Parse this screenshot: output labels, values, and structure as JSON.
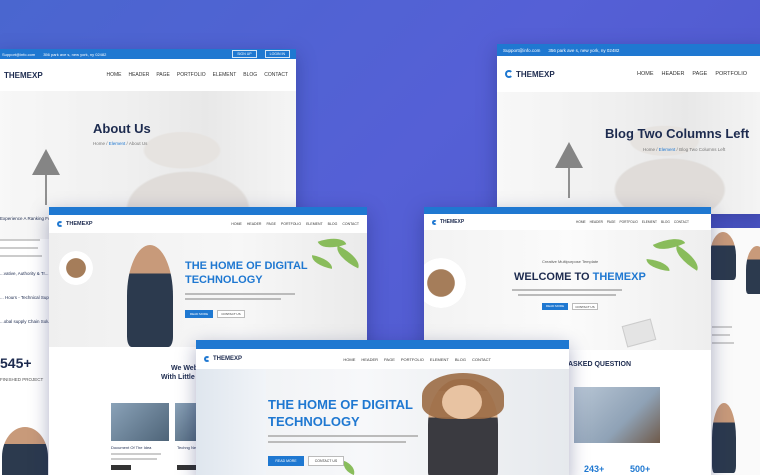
{
  "colors": {
    "accent": "#1f78d1",
    "bg_gradient": "#4a66cf"
  },
  "about": {
    "contact_email": "Support@info.com",
    "contact_address": "356 park ave s, new york, ny 02482",
    "signup": "SIGN UP",
    "login": "LOGIN IN",
    "logo": "THEMEXP",
    "menu": [
      "HOME",
      "HEADER",
      "PAGE",
      "PORTFOLIO",
      "ELEMENT",
      "BLOG",
      "CONTACT"
    ],
    "title": "About Us",
    "crumb_home": "Home",
    "crumb_mid": "Element",
    "crumb_last": "About Us",
    "side_texts": [
      "Experience A Ranking Fo...",
      "...vative, Authority & Tr...",
      "... Hours - Technical Sup...",
      "...obal supply Chain Solu..."
    ],
    "stat_number": "545+",
    "stat_label": "FINISHED PROJECT"
  },
  "blog": {
    "contact_email": "Support@info.com",
    "contact_address": "356 park ave s, new york, ny 02482",
    "logo": "THEMEXP",
    "menu": [
      "HOME",
      "HEADER",
      "PAGE",
      "PORTFOLIO"
    ],
    "title": "Blog Two Columns Left",
    "crumb_home": "Home",
    "crumb_mid": "Element",
    "crumb_last": "Blog Two Columns Left"
  },
  "digital1": {
    "logo": "THEMEXP",
    "menu": [
      "HOME",
      "HEADER",
      "PAGE",
      "PORTFOLIO",
      "ELEMENT",
      "BLOG",
      "CONTACT"
    ],
    "title_line1": "THE HOME OF DIGITAL",
    "title_line2": "TECHNOLOGY",
    "read_more": "READ MORE",
    "contact_us": "CONTACT US",
    "below_title_1": "We Web",
    "below_title_2": "With Little I",
    "card1_title": "Document Of The Idea",
    "card2_title": "Techng Ne"
  },
  "welcome": {
    "logo": "THEMEXP",
    "menu": [
      "HOME",
      "HEADER",
      "PAGE",
      "PORTFOLIO",
      "ELEMENT",
      "BLOG",
      "CONTACT"
    ],
    "subtitle": "Creative Multipurpose Template",
    "title_prefix": "WELCOME TO ",
    "title_brand": "THEMEXP",
    "read_more": "READ MORE",
    "contact_us": "CONTACT US",
    "faq_title": "ASKED QUESTION",
    "stat1": "243+",
    "stat2": "500+"
  },
  "digital2": {
    "logo": "THEMEXP",
    "menu": [
      "HOME",
      "HEADER",
      "PAGE",
      "PORTFOLIO",
      "ELEMENT",
      "BLOG",
      "CONTACT"
    ],
    "title_line1": "THE HOME OF DIGITAL",
    "title_line2": "TECHNOLOGY",
    "read_more": "READ MORE",
    "contact_us": "CONTACT US"
  }
}
